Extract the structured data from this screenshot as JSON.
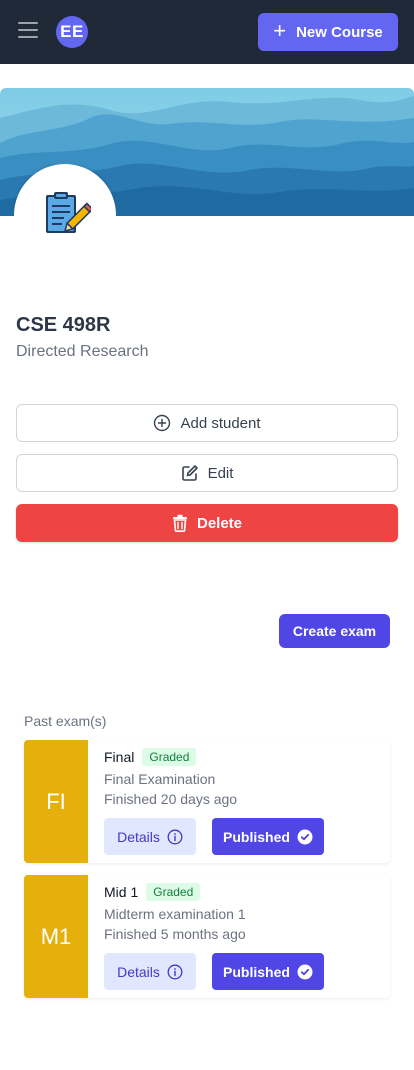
{
  "topbar": {
    "avatar_initials": "EE",
    "new_course_label": "New Course",
    "menu_icon": "hamburger-icon",
    "plus_icon": "plus-icon"
  },
  "course": {
    "code": "CSE 498R",
    "name": "Directed Research",
    "icon": "document-edit-icon"
  },
  "actions": {
    "add_student": "Add student",
    "edit": "Edit",
    "delete": "Delete"
  },
  "create_exam_label": "Create exam",
  "past_exams": {
    "heading": "Past exam(s)",
    "items": [
      {
        "initials": "FI",
        "title": "Final",
        "status": "Graded",
        "description": "Final Examination",
        "finished": "Finished 20 days ago",
        "details_label": "Details",
        "published_label": "Published"
      },
      {
        "initials": "M1",
        "title": "Mid 1",
        "status": "Graded",
        "description": "Midterm examination 1",
        "finished": "Finished 5 months ago",
        "details_label": "Details",
        "published_label": "Published"
      }
    ]
  },
  "colors": {
    "topbar": "#1f2937",
    "accent": "#6366f1",
    "primary": "#4f46e5",
    "danger": "#ef4444",
    "exam_tile": "#e5b00b",
    "graded_badge_bg": "#dcfce7",
    "graded_badge_text": "#15803d"
  }
}
